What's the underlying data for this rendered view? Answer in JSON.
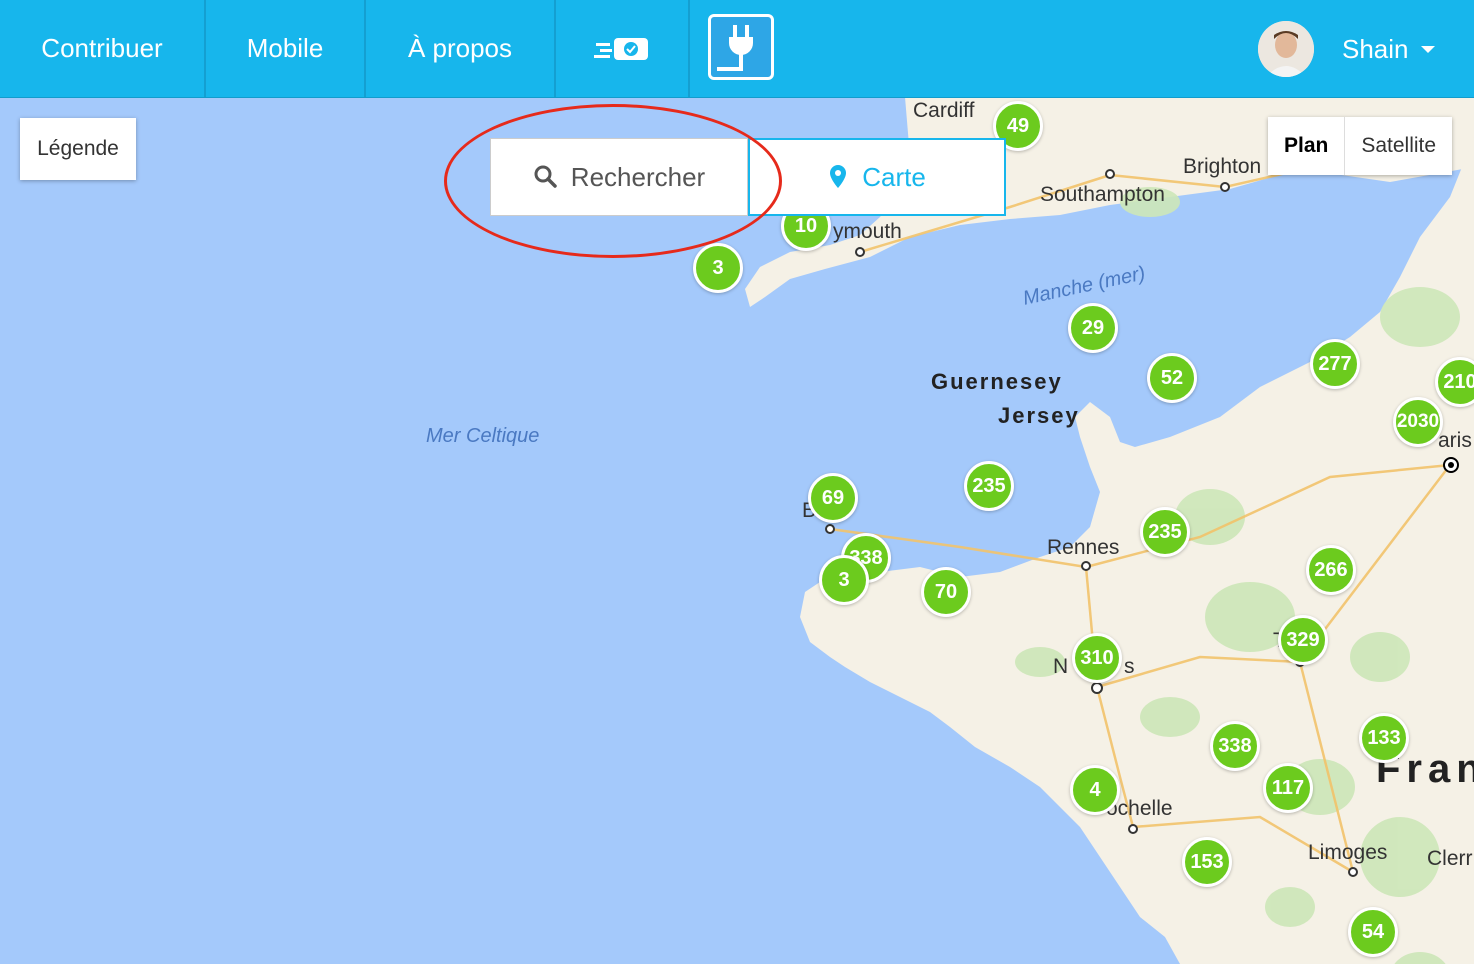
{
  "nav": {
    "contribute": "Contribuer",
    "mobile": "Mobile",
    "about": "À propos",
    "user_name": "Shain",
    "pay_icon": "payment-card-icon",
    "logo_icon": "plug-logo-icon"
  },
  "controls": {
    "legend": "Légende",
    "search": "Rechercher",
    "map": "Carte",
    "map_type": [
      "Plan",
      "Satellite"
    ]
  },
  "map_labels": {
    "cardiff": "Cardiff",
    "southampton": "Southampton",
    "brighton": "Brighton",
    "plymouth": "ymouth",
    "manche": "Manche (mer)",
    "guernesey": "Guernesey",
    "jersey": "Jersey",
    "mer_celtique": "Mer Celtique",
    "brest": "B",
    "rennes": "Rennes",
    "nantes_n": "N",
    "nantes_s": "s",
    "la_rochelle": "ochelle",
    "limoges": "Limoges",
    "clermont": "Clerr",
    "paris": "aris",
    "t_label": "T",
    "france": "Fran"
  },
  "clusters": [
    "49",
    "10",
    "3",
    "29",
    "52",
    "277",
    "210",
    "2030",
    "69",
    "235",
    "235",
    "338",
    "3",
    "70",
    "266",
    "329",
    "310",
    "338",
    "133",
    "4",
    "117",
    "153",
    "54"
  ],
  "colors": {
    "topbar": "#17b6ec",
    "cluster": "#6ccb1e",
    "sea": "#a4c9fb",
    "land": "#f5f1e6",
    "annotation": "#e62a1b"
  }
}
